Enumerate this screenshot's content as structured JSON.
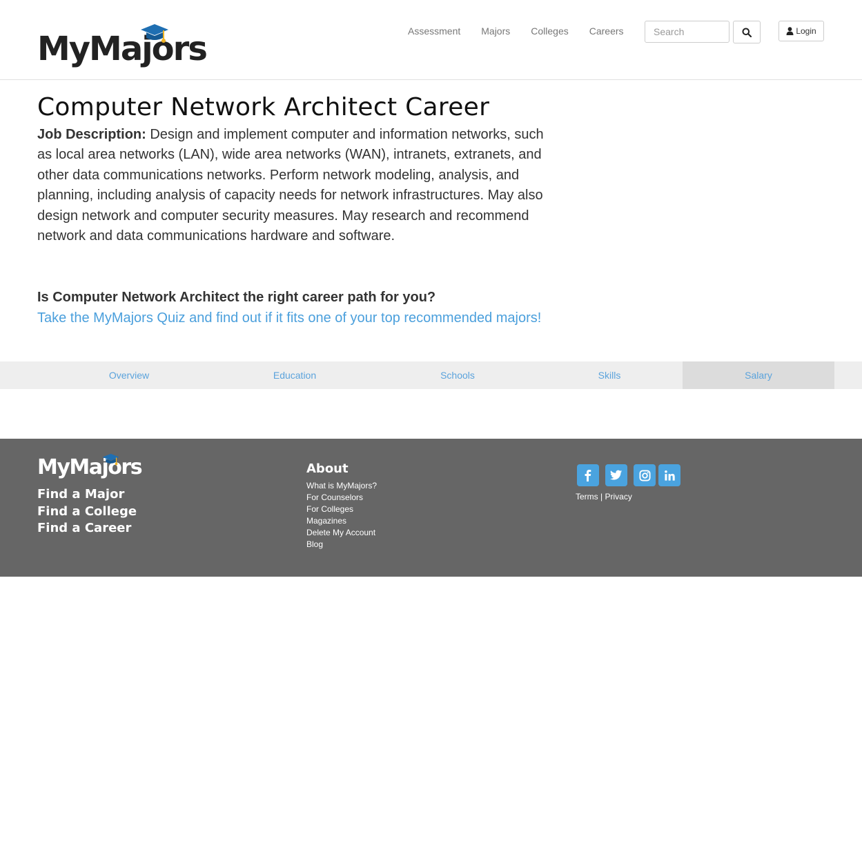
{
  "header": {
    "logo_text": "MyMajors",
    "nav": [
      {
        "label": "Assessment"
      },
      {
        "label": "Majors"
      },
      {
        "label": "Colleges"
      },
      {
        "label": "Careers"
      }
    ],
    "search_placeholder": "Search",
    "login_label": "Login"
  },
  "main": {
    "title": "Computer Network Architect Career",
    "job_desc_label": "Job Description:",
    "job_desc_text": " Design and implement computer and information networks, such as local area networks (LAN), wide area networks (WAN), intranets, extranets, and other data communications networks. Perform network modeling, analysis, and planning, including analysis of capacity needs for network infrastructures. May also design network and computer security measures. May research and recommend network and data communications hardware and software.",
    "question": "Is Computer Network Architect the right career path for you?",
    "quiz_link": "Take the MyMajors Quiz and find out if it fits one of your top recommended majors!"
  },
  "tabs": [
    {
      "label": "Overview"
    },
    {
      "label": "Education"
    },
    {
      "label": "Schools"
    },
    {
      "label": "Skills"
    },
    {
      "label": "Salary",
      "active": true
    }
  ],
  "footer": {
    "logo_text": "MyMajors",
    "find_links": [
      "Find a Major",
      "Find a College",
      "Find a Career"
    ],
    "about_title": "About",
    "about_links": [
      "What is MyMajors?",
      "For Counselors",
      "For Colleges",
      "Magazines",
      "Delete My Account",
      "Blog"
    ],
    "social": [
      "facebook-icon",
      "twitter-icon",
      "instagram-icon",
      "linkedin-icon"
    ],
    "terms": "Terms",
    "separator": "|",
    "privacy": "Privacy"
  },
  "colors": {
    "link_blue": "#4a9fdc",
    "footer_bg": "#666666",
    "social_blue": "#4aa3df",
    "cap_blue": "#1f6fb2",
    "tassel_gold": "#f0b323"
  }
}
